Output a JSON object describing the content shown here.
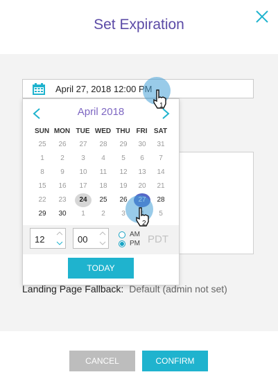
{
  "modal": {
    "title": "Set Expiration",
    "close_icon": "close-icon"
  },
  "expiration": {
    "value": "April 27, 2018 12:00 PM",
    "icon": "calendar-icon"
  },
  "datepicker": {
    "month_label": "April 2018",
    "weekdays": [
      "SUN",
      "MON",
      "TUE",
      "WED",
      "THU",
      "FRI",
      "SAT"
    ],
    "weeks": [
      [
        "25",
        "26",
        "27",
        "28",
        "29",
        "30",
        "31"
      ],
      [
        "1",
        "2",
        "3",
        "4",
        "5",
        "6",
        "7"
      ],
      [
        "8",
        "9",
        "10",
        "11",
        "12",
        "13",
        "14"
      ],
      [
        "15",
        "16",
        "17",
        "18",
        "19",
        "20",
        "21"
      ],
      [
        "22",
        "23",
        "24",
        "25",
        "26",
        "27",
        "28"
      ],
      [
        "29",
        "30",
        "1",
        "2",
        "3",
        "4",
        "5"
      ]
    ],
    "today": "24",
    "selected": "27",
    "hour": "12",
    "minute": "00",
    "am_label": "AM",
    "pm_label": "PM",
    "meridiem": "PM",
    "timezone": "PDT",
    "today_button": "TODAY"
  },
  "fallback": {
    "label": "Landing Page Fallback:",
    "value": "Default (admin not set)"
  },
  "footer": {
    "cancel_label": "CANCEL",
    "confirm_label": "CONFIRM"
  },
  "annotations": {
    "step_1": "1",
    "step_2": "2"
  },
  "colors": {
    "accent": "#1fb3ce",
    "title": "#5b4aa6",
    "selected_day": "#5667c7"
  }
}
